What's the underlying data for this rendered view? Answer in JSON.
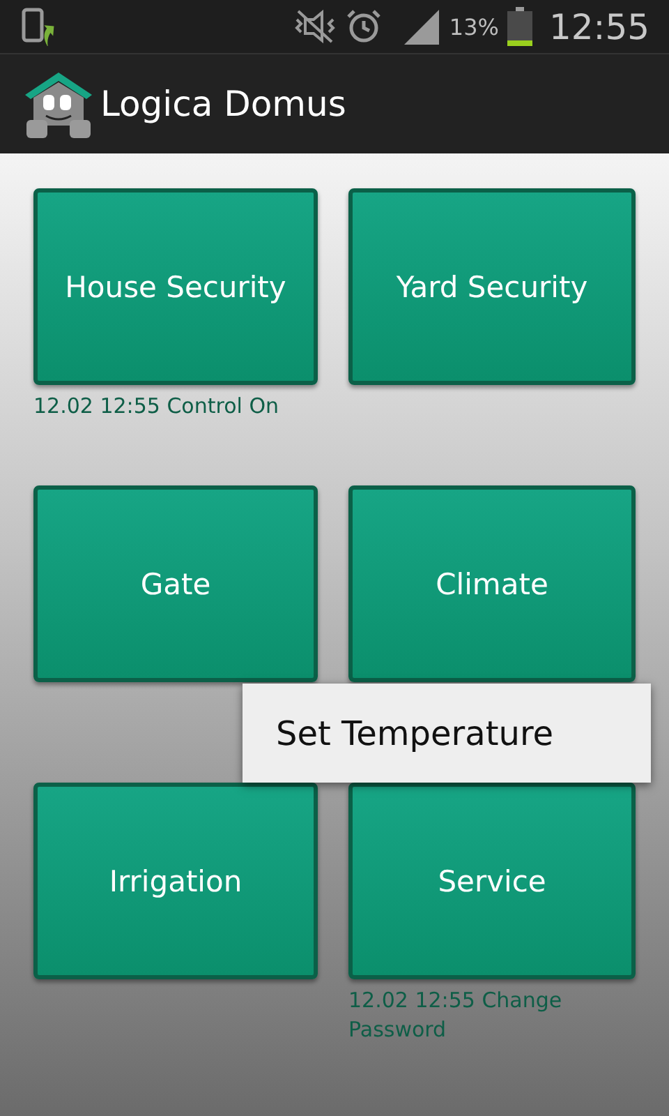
{
  "status_bar": {
    "battery": "13%",
    "time": "12:55"
  },
  "app_bar": {
    "title": "Logica Domus"
  },
  "tiles": [
    {
      "label": "House Security",
      "note": "12.02 12:55 Control On"
    },
    {
      "label": "Yard Security"
    },
    {
      "label": "Gate"
    },
    {
      "label": "Climate"
    },
    {
      "label": "Irrigation"
    },
    {
      "label": "Service",
      "note": "12.02 12:55 Change Password"
    }
  ],
  "popup_menu": {
    "items": [
      "Set Temperature"
    ]
  }
}
